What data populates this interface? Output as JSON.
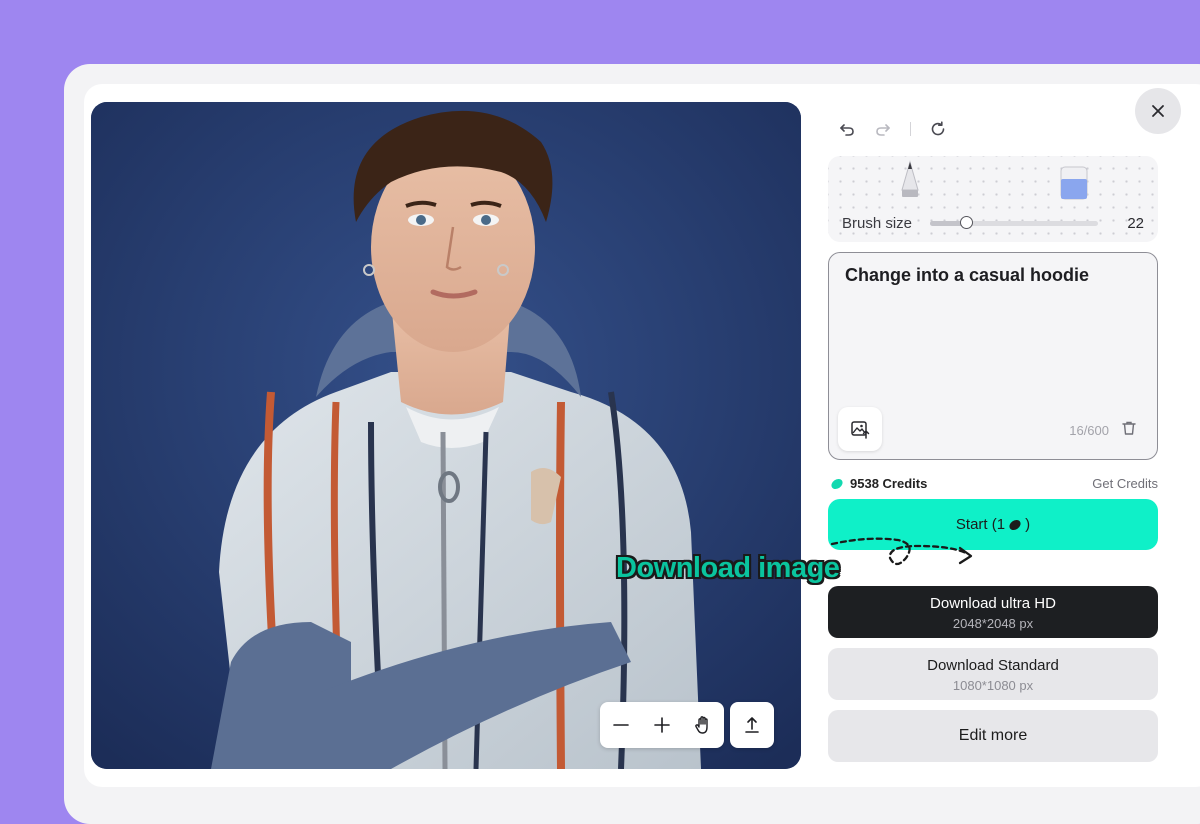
{
  "colors": {
    "background": "#9e86f0",
    "accent": "#0ff0c8",
    "dark_button": "#1d1f22",
    "annotation": "#0ac49e"
  },
  "toolbar": {
    "undo_icon": "undo-icon",
    "redo_icon": "redo-icon",
    "reset_icon": "refresh-icon"
  },
  "brush": {
    "label": "Brush size",
    "value": "22",
    "slider_value": 22,
    "slider_min": 0,
    "slider_max": 100,
    "tools": [
      "pencil-icon",
      "eraser-icon"
    ]
  },
  "prompt": {
    "text": "Change into a casual hoodie",
    "count": "16/600"
  },
  "credits": {
    "amount": "9538 Credits",
    "get_label": "Get Credits"
  },
  "start": {
    "label": "Start (1",
    "label_end": ")"
  },
  "annotation": {
    "text": "Download image"
  },
  "download_hd": {
    "label": "Download ultra HD",
    "size": "2048*2048 px"
  },
  "download_standard": {
    "label": "Download Standard",
    "size": "1080*1080 px"
  },
  "edit_more": {
    "label": "Edit more"
  },
  "canvas_controls": [
    "zoom-out-icon",
    "zoom-in-icon",
    "hand-pan-icon",
    "export-icon"
  ]
}
